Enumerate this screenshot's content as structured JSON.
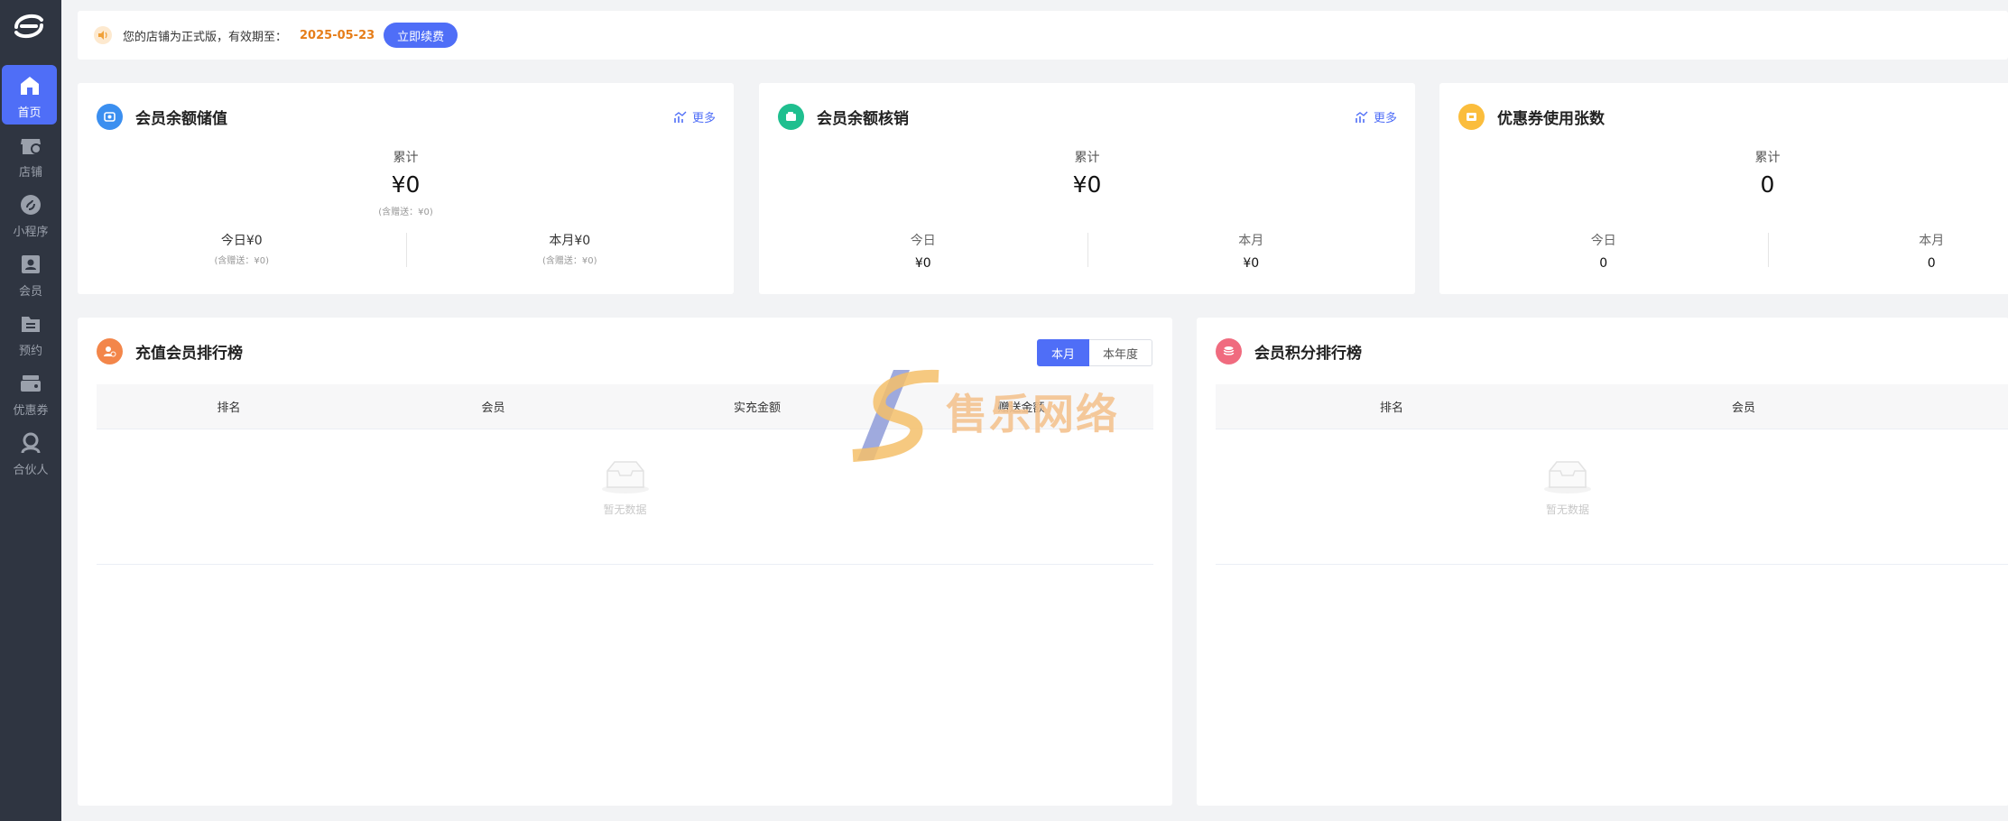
{
  "sidebar": {
    "items": [
      {
        "label": "首页",
        "icon": "home-icon"
      },
      {
        "label": "店铺",
        "icon": "store-icon"
      },
      {
        "label": "小程序",
        "icon": "mini-program-icon"
      },
      {
        "label": "会员",
        "icon": "member-icon"
      },
      {
        "label": "预约",
        "icon": "appointment-icon"
      },
      {
        "label": "优惠券",
        "icon": "coupon-icon"
      },
      {
        "label": "合伙人",
        "icon": "partner-icon"
      }
    ]
  },
  "notice": {
    "message": "您的店铺为正式版，有效期至：",
    "date": "2025-05-23",
    "renew_label": "立即续费"
  },
  "stats": [
    {
      "title": "会员余额储值",
      "more": "更多",
      "cumulative_label": "累计",
      "cumulative_value": "¥0",
      "cumulative_sub": "(含赠送：¥0)",
      "today": "今日¥0",
      "today_sub": "(含赠送：¥0)",
      "month": "本月¥0",
      "month_sub": "(含赠送：¥0)"
    },
    {
      "title": "会员余额核销",
      "more": "更多",
      "cumulative_label": "累计",
      "cumulative_value": "¥0",
      "today_label": "今日",
      "today_value": "¥0",
      "month_label": "本月",
      "month_value": "¥0"
    },
    {
      "title": "优惠券使用张数",
      "cumulative_label": "累计",
      "cumulative_value": "0",
      "today_label": "今日",
      "today_value": "0",
      "month_label": "本月",
      "month_value": "0"
    }
  ],
  "recharge_rank": {
    "title": "充值会员排行榜",
    "tab_month": "本月",
    "tab_year": "本年度",
    "columns": [
      "排名",
      "会员",
      "实充金额",
      "赠送金额"
    ],
    "empty_text": "暂无数据"
  },
  "points_rank": {
    "title": "会员积分排行榜",
    "columns": [
      "排名",
      "会员"
    ],
    "empty_text": "暂无数据"
  },
  "watermark": {
    "text": "售乐网络"
  },
  "colors": {
    "accent": "#4f6ef7",
    "sidebar": "#2f3541",
    "date": "#e67e1a"
  }
}
